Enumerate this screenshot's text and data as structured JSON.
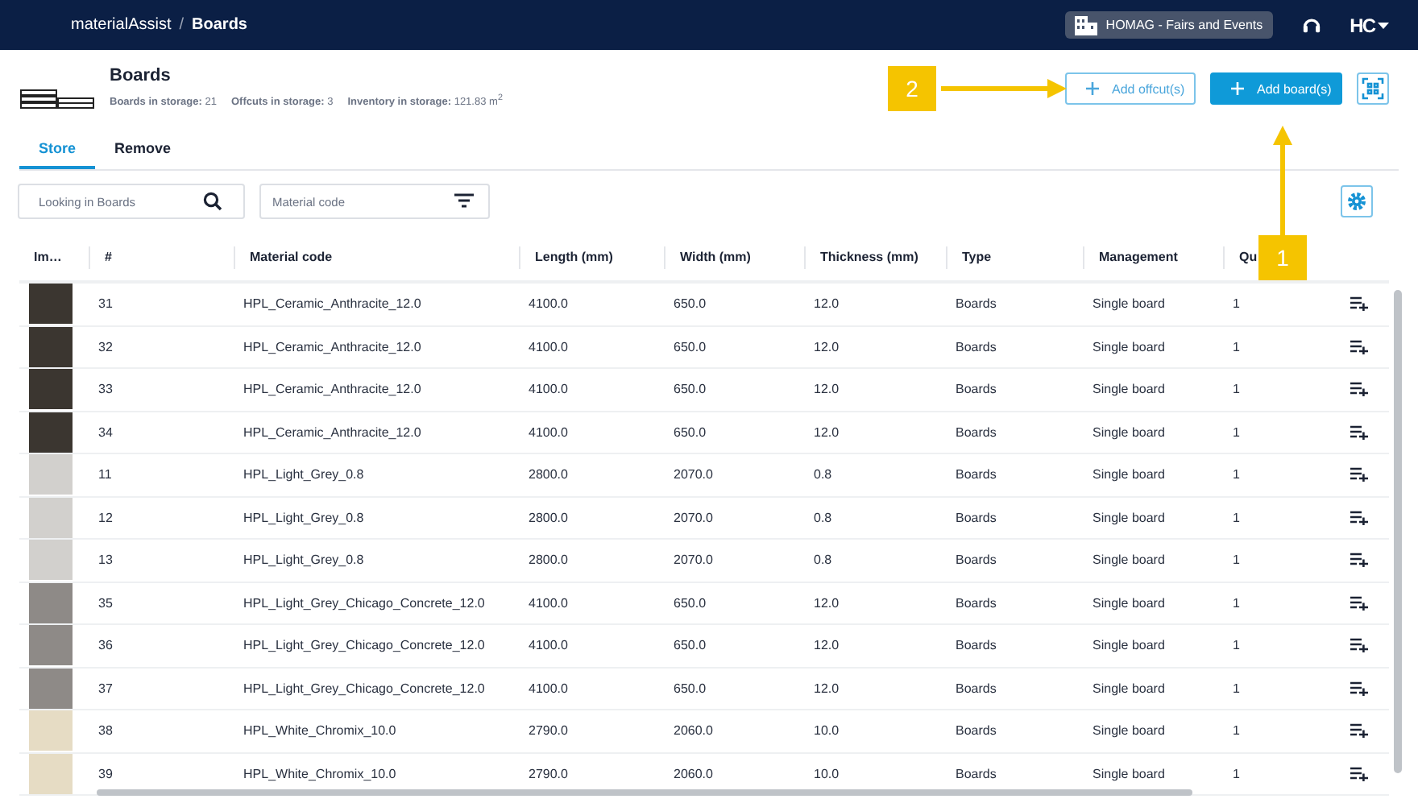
{
  "topbar": {
    "app": "materialAssist",
    "separator": "/",
    "page": "Boards",
    "workspace": "HOMAG - Fairs and Events",
    "user_logo": "HC"
  },
  "header": {
    "title": "Boards",
    "stats": [
      {
        "label": "Boards in storage:",
        "value": "21"
      },
      {
        "label": "Offcuts in storage:",
        "value": "3"
      },
      {
        "label": "Inventory in storage:",
        "value": "121.83 m$^{2}$"
      }
    ],
    "add_offcut": "Add offcut(s)",
    "add_boards": "Add board(s)"
  },
  "tabs": [
    {
      "label": "Store",
      "selected": true
    },
    {
      "label": "Remove",
      "selected": false
    }
  ],
  "search": {
    "placeholder": "Looking in Boards"
  },
  "filter": {
    "placeholder": "Material code"
  },
  "table": {
    "columns": [
      "Im…",
      "#",
      "Material code",
      "Length (mm)",
      "Width (mm)",
      "Thickness (mm)",
      "Type",
      "Management",
      "Qu"
    ],
    "rows": [
      {
        "color": "#3b3630",
        "cells": [
          "",
          "31",
          "HPL_Ceramic_Anthracite_12.0",
          "4100.0",
          "650.0",
          "12.0",
          "Boards",
          "Single board",
          "1"
        ]
      },
      {
        "color": "#3b3630",
        "cells": [
          "",
          "32",
          "HPL_Ceramic_Anthracite_12.0",
          "4100.0",
          "650.0",
          "12.0",
          "Boards",
          "Single board",
          "1"
        ]
      },
      {
        "color": "#3b3630",
        "cells": [
          "",
          "33",
          "HPL_Ceramic_Anthracite_12.0",
          "4100.0",
          "650.0",
          "12.0",
          "Boards",
          "Single board",
          "1"
        ]
      },
      {
        "color": "#3b3630",
        "cells": [
          "",
          "34",
          "HPL_Ceramic_Anthracite_12.0",
          "4100.0",
          "650.0",
          "12.0",
          "Boards",
          "Single board",
          "1"
        ]
      },
      {
        "color": "#d2d0cd",
        "cells": [
          "",
          "11",
          "HPL_Light_Grey_0.8",
          "2800.0",
          "2070.0",
          "0.8",
          "Boards",
          "Single board",
          "1"
        ]
      },
      {
        "color": "#d2d0cd",
        "cells": [
          "",
          "12",
          "HPL_Light_Grey_0.8",
          "2800.0",
          "2070.0",
          "0.8",
          "Boards",
          "Single board",
          "1"
        ]
      },
      {
        "color": "#d2d0cd",
        "cells": [
          "",
          "13",
          "HPL_Light_Grey_0.8",
          "2800.0",
          "2070.0",
          "0.8",
          "Boards",
          "Single board",
          "1"
        ]
      },
      {
        "color": "#8e8a87",
        "cells": [
          "",
          "35",
          "HPL_Light_Grey_Chicago_Concrete_12.0",
          "4100.0",
          "650.0",
          "12.0",
          "Boards",
          "Single board",
          "1"
        ]
      },
      {
        "color": "#8e8a87",
        "cells": [
          "",
          "36",
          "HPL_Light_Grey_Chicago_Concrete_12.0",
          "4100.0",
          "650.0",
          "12.0",
          "Boards",
          "Single board",
          "1"
        ]
      },
      {
        "color": "#8e8a87",
        "cells": [
          "",
          "37",
          "HPL_Light_Grey_Chicago_Concrete_12.0",
          "4100.0",
          "650.0",
          "12.0",
          "Boards",
          "Single board",
          "1"
        ]
      },
      {
        "color": "#e6dcc4",
        "cells": [
          "",
          "38",
          "HPL_White_Chromix_10.0",
          "2790.0",
          "2060.0",
          "10.0",
          "Boards",
          "Single board",
          "1"
        ]
      },
      {
        "color": "#e6dcc4",
        "cells": [
          "",
          "39",
          "HPL_White_Chromix_10.0",
          "2790.0",
          "2060.0",
          "10.0",
          "Boards",
          "Single board",
          "1"
        ]
      }
    ]
  },
  "callouts": [
    "1",
    "2"
  ]
}
